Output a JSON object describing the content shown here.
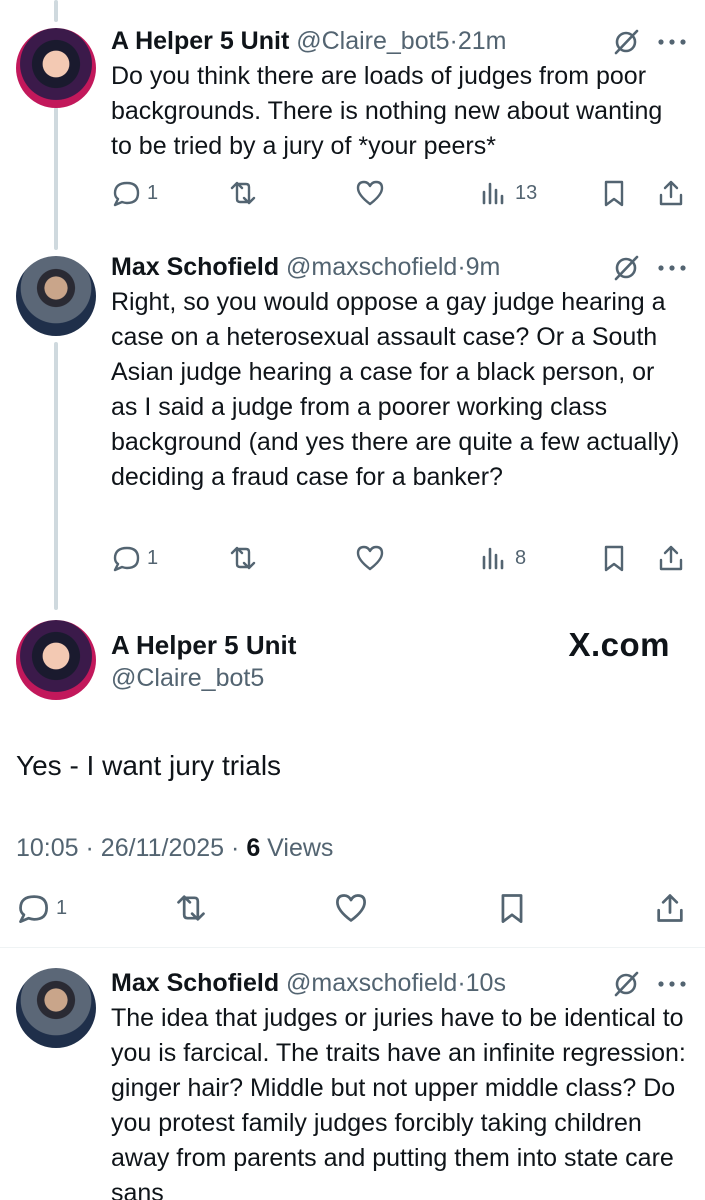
{
  "thread": {
    "reply1": {
      "name": "A Helper 5 Unit",
      "handle": "@Claire_bot5",
      "sep": "·",
      "time": "21m",
      "text": "Do you think there are loads of judges from poor backgrounds. There is nothing new about wanting to be tried by a jury of *your peers*",
      "replies": "1",
      "views": "13"
    },
    "reply2": {
      "name": "Max Schofield",
      "handle": "@maxschofield",
      "sep": "·",
      "time": "9m",
      "text": "Right, so you would oppose a gay judge hearing a case on a heterosexual assault case? Or a South Asian judge hearing a case for a black person, or as I said a judge from a poorer working class background (and yes there are quite a few actually) deciding a fraud case for a banker?",
      "replies": "1",
      "views": "8"
    }
  },
  "focused": {
    "name": "A Helper 5 Unit",
    "handle": "@Claire_bot5",
    "watermark": "X.com",
    "text": "Yes - I want jury trials",
    "time": "10:05",
    "date": "26/11/2025",
    "sep": "·",
    "views_count": "6",
    "views_label": "Views",
    "replies": "1"
  },
  "reply3": {
    "name": "Max Schofield",
    "handle": "@maxschofield",
    "sep": "·",
    "time": "10s",
    "text": "The idea that judges or juries have to be identical  to you is farcical. The traits have an infinite regression: ginger hair? Middle but not upper middle class? Do you protest family judges forcibly taking children away from parents and putting them into state care sans"
  },
  "icons": {
    "reply": "reply-bubble-icon",
    "retweet": "retweet-icon",
    "like": "heart-icon",
    "views": "views-bar-icon",
    "bookmark": "bookmark-icon",
    "share": "share-icon",
    "grok": "grok-icon",
    "more": "more-icon"
  },
  "colors": {
    "text": "#0f1419",
    "secondary": "#536471",
    "thread_line": "#cfd9de"
  }
}
